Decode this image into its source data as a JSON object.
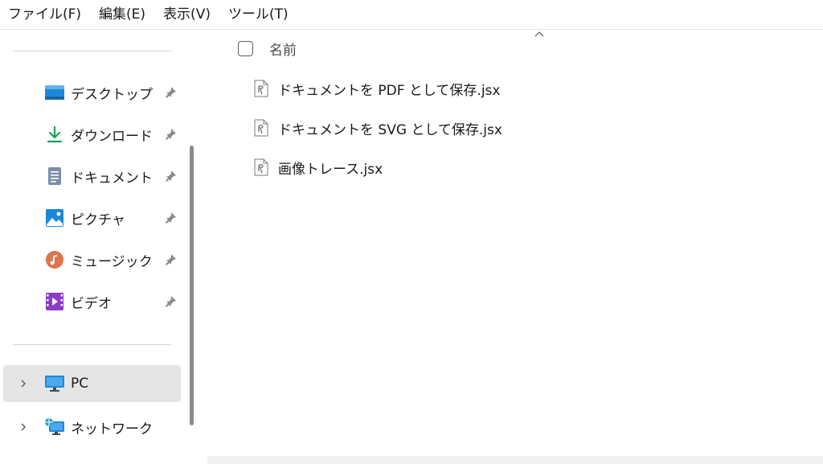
{
  "menubar": {
    "items": [
      "ファイル(F)",
      "編集(E)",
      "表示(V)",
      "ツール(T)"
    ]
  },
  "sidebar": {
    "quick_access": [
      {
        "label": "デスクトップ",
        "icon": "desktop-icon",
        "pinned": true
      },
      {
        "label": "ダウンロード",
        "icon": "download-icon",
        "pinned": true
      },
      {
        "label": "ドキュメント",
        "icon": "document-icon",
        "pinned": true
      },
      {
        "label": "ピクチャ",
        "icon": "pictures-icon",
        "pinned": true
      },
      {
        "label": "ミュージック",
        "icon": "music-icon",
        "pinned": true
      },
      {
        "label": "ビデオ",
        "icon": "video-icon",
        "pinned": true
      }
    ],
    "locations": [
      {
        "label": "PC",
        "icon": "pc-icon",
        "selected": true
      },
      {
        "label": "ネットワーク",
        "icon": "network-icon",
        "selected": false
      }
    ]
  },
  "main": {
    "column_header": "名前",
    "files": [
      {
        "name": "ドキュメントを PDF として保存.jsx",
        "icon": "script-file-icon"
      },
      {
        "name": "ドキュメントを SVG として保存.jsx",
        "icon": "script-file-icon"
      },
      {
        "name": "画像トレース.jsx",
        "icon": "script-file-icon"
      }
    ]
  },
  "colors": {
    "selected_bg": "#e5e5e5",
    "divider": "#d5d5d5",
    "scrollbar": "#8a8a8a",
    "accent_blue": "#1e88d8",
    "download_green": "#1b9e5a",
    "music_orange": "#e0734a",
    "video_purple": "#8a3cc8"
  }
}
